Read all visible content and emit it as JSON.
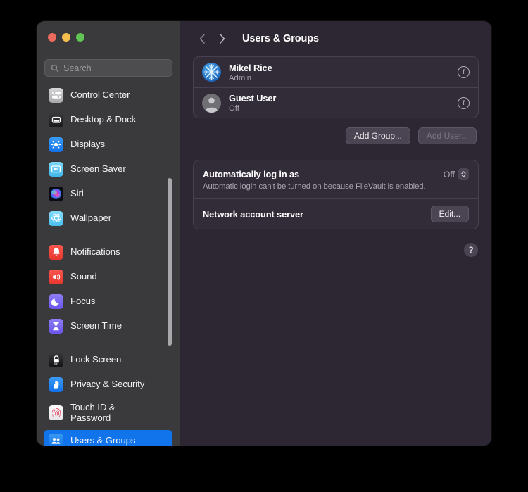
{
  "window": {
    "traffic_lights": [
      {
        "name": "close",
        "color": "#ed6a5f"
      },
      {
        "name": "minimize",
        "color": "#f5bf4f"
      },
      {
        "name": "zoom",
        "color": "#61c454"
      }
    ]
  },
  "search": {
    "placeholder": "Search",
    "value": "",
    "icon": "search-icon"
  },
  "sidebar": {
    "groups": [
      {
        "items": [
          {
            "label": "Control Center",
            "icon": "control-center-icon",
            "selected": false
          },
          {
            "label": "Desktop & Dock",
            "icon": "desktop-dock-icon",
            "selected": false
          },
          {
            "label": "Displays",
            "icon": "displays-icon",
            "selected": false
          },
          {
            "label": "Screen Saver",
            "icon": "screen-saver-icon",
            "selected": false
          },
          {
            "label": "Siri",
            "icon": "siri-icon",
            "selected": false
          },
          {
            "label": "Wallpaper",
            "icon": "wallpaper-icon",
            "selected": false
          }
        ]
      },
      {
        "items": [
          {
            "label": "Notifications",
            "icon": "notifications-icon",
            "selected": false
          },
          {
            "label": "Sound",
            "icon": "sound-icon",
            "selected": false
          },
          {
            "label": "Focus",
            "icon": "focus-icon",
            "selected": false
          },
          {
            "label": "Screen Time",
            "icon": "screen-time-icon",
            "selected": false
          }
        ]
      },
      {
        "items": [
          {
            "label": "Lock Screen",
            "icon": "lock-screen-icon",
            "selected": false
          },
          {
            "label": "Privacy & Security",
            "icon": "privacy-security-icon",
            "selected": false
          },
          {
            "label": "Touch ID &\nPassword",
            "icon": "touch-id-icon",
            "selected": false
          },
          {
            "label": "Users & Groups",
            "icon": "users-groups-icon",
            "selected": true
          }
        ]
      }
    ],
    "selected_accent": "#1274eb"
  },
  "toolbar": {
    "back_icon": "chevron-left-icon",
    "forward_icon": "chevron-right-icon",
    "title": "Users & Groups"
  },
  "users": [
    {
      "name": "Mikel Rice",
      "status": "Admin",
      "avatar": "snowflake-avatar",
      "info_icon": "info-icon"
    },
    {
      "name": "Guest User",
      "status": "Off",
      "avatar": "person-avatar",
      "info_icon": "info-icon"
    }
  ],
  "actions": {
    "add_group_label": "Add Group...",
    "add_user_label": "Add User...",
    "add_user_disabled": true,
    "highlight_color": "#f51a0e",
    "highlight_target": "add-user-button"
  },
  "settings": {
    "auto_login": {
      "title": "Automatically log in as",
      "description": "Automatic login can't be turned on because FileVault is enabled.",
      "value": "Off",
      "stepper_icon": "chevron-up-down-icon"
    },
    "network_account": {
      "title": "Network account server",
      "button_label": "Edit..."
    }
  },
  "help": {
    "label": "?",
    "icon": "help-icon"
  }
}
